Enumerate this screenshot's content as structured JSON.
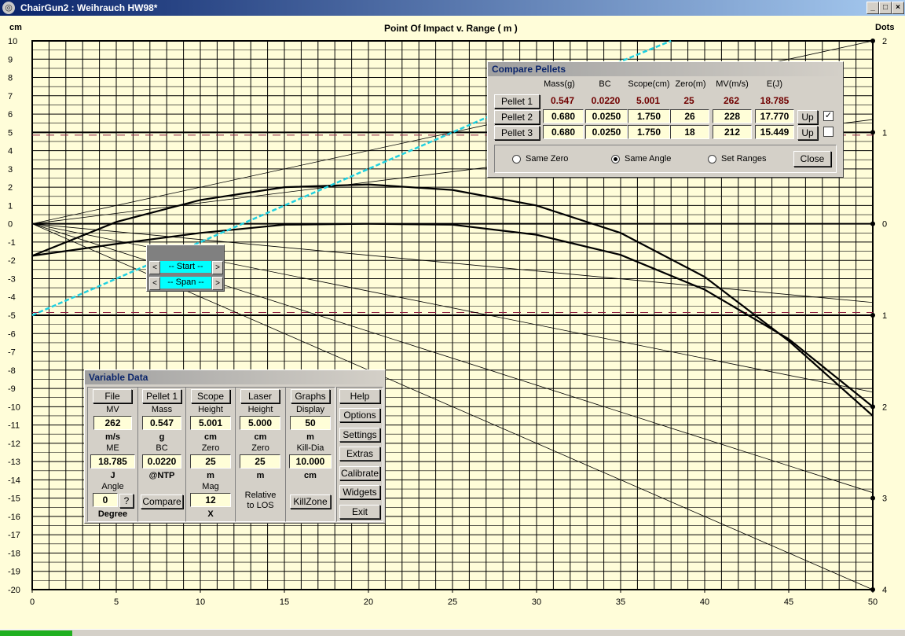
{
  "window": {
    "title": "ChairGun2 : Weihrauch HW98*"
  },
  "chart": {
    "title": "Point Of Impact v. Range ( m )",
    "left_unit": "cm",
    "right_unit": "Dots",
    "x_ticks": [
      "0",
      "5",
      "10",
      "15",
      "20",
      "25",
      "30",
      "35",
      "40",
      "45",
      "50"
    ],
    "y_ticks": [
      "10",
      "9",
      "8",
      "7",
      "6",
      "5",
      "4",
      "3",
      "2",
      "1",
      "0",
      "-1",
      "-2",
      "-3",
      "-4",
      "-5",
      "-6",
      "-7",
      "-8",
      "-9",
      "-10",
      "-11",
      "-12",
      "-13",
      "-14",
      "-15",
      "-16",
      "-17",
      "-18",
      "-19",
      "-20"
    ],
    "dots_ticks": [
      "2",
      "1",
      "0",
      "1",
      "2",
      "3",
      "4"
    ]
  },
  "chart_data": {
    "type": "line",
    "xlabel": "Point Of Impact v. Range ( m )",
    "ylabel": "cm",
    "xlim": [
      0,
      50
    ],
    "ylim": [
      -20,
      10
    ],
    "series": [
      {
        "x": [
          0,
          5,
          10,
          15,
          20,
          25,
          30,
          35,
          40,
          45,
          50
        ],
        "y": [
          -1.75,
          0.1,
          1.3,
          2.0,
          2.15,
          1.85,
          1.0,
          -0.5,
          -2.9,
          -6.4,
          -10.5
        ]
      },
      {
        "x": [
          0,
          5,
          10,
          15,
          20,
          25,
          30,
          35,
          40,
          45,
          50
        ],
        "y": [
          -1.75,
          -1.1,
          -0.5,
          -0.05,
          0.0,
          -0.05,
          -0.6,
          -1.7,
          -3.6,
          -6.3,
          -10.0
        ]
      },
      {
        "x": [
          0,
          10,
          20,
          30,
          38
        ],
        "y": [
          -5,
          -1.0,
          3.0,
          7.0,
          10.0
        ]
      }
    ]
  },
  "compare": {
    "title": "Compare Pellets",
    "headers": [
      "Mass(g)",
      "BC",
      "Scope(cm)",
      "Zero(m)",
      "MV(m/s)",
      "E(J)"
    ],
    "pellets": [
      {
        "label": "Pellet 1",
        "mass": "0.547",
        "bc": "0.0220",
        "scope": "5.001",
        "zero": "25",
        "mv": "262",
        "e": "18.785"
      },
      {
        "label": "Pellet 2",
        "mass": "0.680",
        "bc": "0.0250",
        "scope": "1.750",
        "zero": "26",
        "mv": "228",
        "e": "17.770",
        "up": "Up",
        "checked": "✓"
      },
      {
        "label": "Pellet 3",
        "mass": "0.680",
        "bc": "0.0250",
        "scope": "1.750",
        "zero": "18",
        "mv": "212",
        "e": "15.449",
        "up": "Up",
        "checked": ""
      }
    ],
    "radios": [
      "Same Zero",
      "Same Angle",
      "Set Ranges"
    ],
    "close": "Close"
  },
  "startspan": {
    "start": "-- Start --",
    "span": "-- Span --",
    "left": "<",
    "right": ">"
  },
  "vardata": {
    "title": "Variable Data",
    "file": "File",
    "mv_label": "MV",
    "mv": "262",
    "mv_unit": "m/s",
    "me_label": "ME",
    "me": "18.785",
    "me_unit": "J",
    "angle_label": "Angle",
    "angle": "0",
    "angle_q": "?",
    "angle_unit": "Degree",
    "pellet": "Pellet 1",
    "mass_label": "Mass",
    "mass": "0.547",
    "mass_unit": "g",
    "bc_label": "BC",
    "bc": "0.0220",
    "bc_unit": "@NTP",
    "compare": "Compare",
    "scope": "Scope",
    "height_label": "Height",
    "height": "5.001",
    "height_unit": "cm",
    "zero_label": "Zero",
    "zero": "25",
    "zero_unit": "m",
    "mag_label": "Mag",
    "mag": "12",
    "mag_unit": "X",
    "laser": "Laser",
    "l_height_label": "Height",
    "l_height": "5.000",
    "l_height_unit": "cm",
    "l_zero_label": "Zero",
    "l_zero": "25",
    "l_zero_unit": "m",
    "relative": "Relative",
    "to_los": "to LOS",
    "graphs": "Graphs",
    "display_label": "Display",
    "display": "50",
    "display_unit": "m",
    "killdia_label": "Kill-Dia",
    "killdia": "10.000",
    "killdia_unit": "cm",
    "killzone": "KillZone",
    "side": [
      "Help",
      "Options",
      "Settings",
      "Extras",
      "Calibrate",
      "Widgets",
      "Exit"
    ]
  }
}
